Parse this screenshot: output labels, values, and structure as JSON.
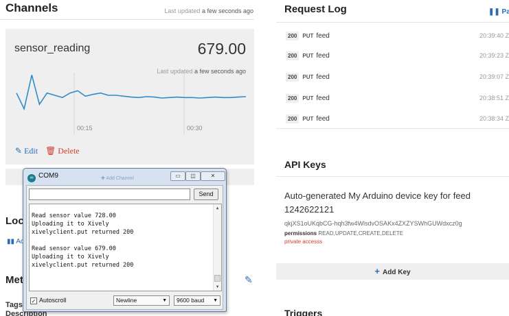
{
  "channels": {
    "title": "Channels",
    "updated_prefix": "Last updated",
    "updated_value": "a few seconds ago",
    "card": {
      "name": "sensor_reading",
      "value": "679.00",
      "updated_prefix": "Last updated",
      "updated_value": "a few seconds ago",
      "edit_label": "Edit",
      "delete_label": "Delete"
    },
    "add_channel_label": "Add Channel"
  },
  "chart_data": {
    "type": "line",
    "x_tick_labels": [
      "00:15",
      "00:30"
    ],
    "series": [
      {
        "values": [
          0.55,
          0.2,
          0.95,
          0.3,
          0.55,
          0.5,
          0.45,
          0.55,
          0.6,
          0.48,
          0.52,
          0.55,
          0.5,
          0.5,
          0.48,
          0.46,
          0.45,
          0.47,
          0.46,
          0.44,
          0.45,
          0.46,
          0.45,
          0.45,
          0.44,
          0.45,
          0.46,
          0.45,
          0.45,
          0.46,
          0.47
        ]
      }
    ],
    "color": "#2e8bc9",
    "grid": true
  },
  "location": {
    "heading": "Loca",
    "link": "Ac"
  },
  "metadata": {
    "heading": "Met",
    "tags_label": "Tags",
    "description_label": "Description"
  },
  "request_log": {
    "title": "Request Log",
    "pause_label": "Pau",
    "rows": [
      {
        "status": "200",
        "method": "PUT",
        "resource": "feed",
        "time": "20:39:40 Z"
      },
      {
        "status": "200",
        "method": "PUT",
        "resource": "feed",
        "time": "20:39:23 Z"
      },
      {
        "status": "200",
        "method": "PUT",
        "resource": "feed",
        "time": "20:39:07 Z"
      },
      {
        "status": "200",
        "method": "PUT",
        "resource": "feed",
        "time": "20:38:51 Z"
      },
      {
        "status": "200",
        "method": "PUT",
        "resource": "feed",
        "time": "20:38:34 Z"
      }
    ]
  },
  "api_keys": {
    "title": "API Keys",
    "description": "Auto-generated My Arduino device key for feed 1242622121",
    "key": "qkjXS1oUKqbCG-hqh3fw4WlsdvOSAKx4ZXZYSWhGUWdxcz0g",
    "permissions_label": "permissions",
    "permissions_value": "READ,UPDATE,CREATE,DELETE",
    "private_label": "private accesss",
    "add_key_label": "Add Key"
  },
  "triggers": {
    "title": "Triggers"
  },
  "serial_monitor": {
    "title": "COM9",
    "input_value": "",
    "send_label": "Send",
    "output_lines": [
      "Read sensor value 728.00",
      "Uploading it to Xively",
      "xivelyclient.put returned 200",
      "",
      "Read sensor value 679.00",
      "Uploading it to Xively",
      "xivelyclient.put returned 200"
    ],
    "autoscroll_label": "Autoscroll",
    "autoscroll_checked": true,
    "line_ending": "Newline",
    "baud": "9600 baud"
  }
}
